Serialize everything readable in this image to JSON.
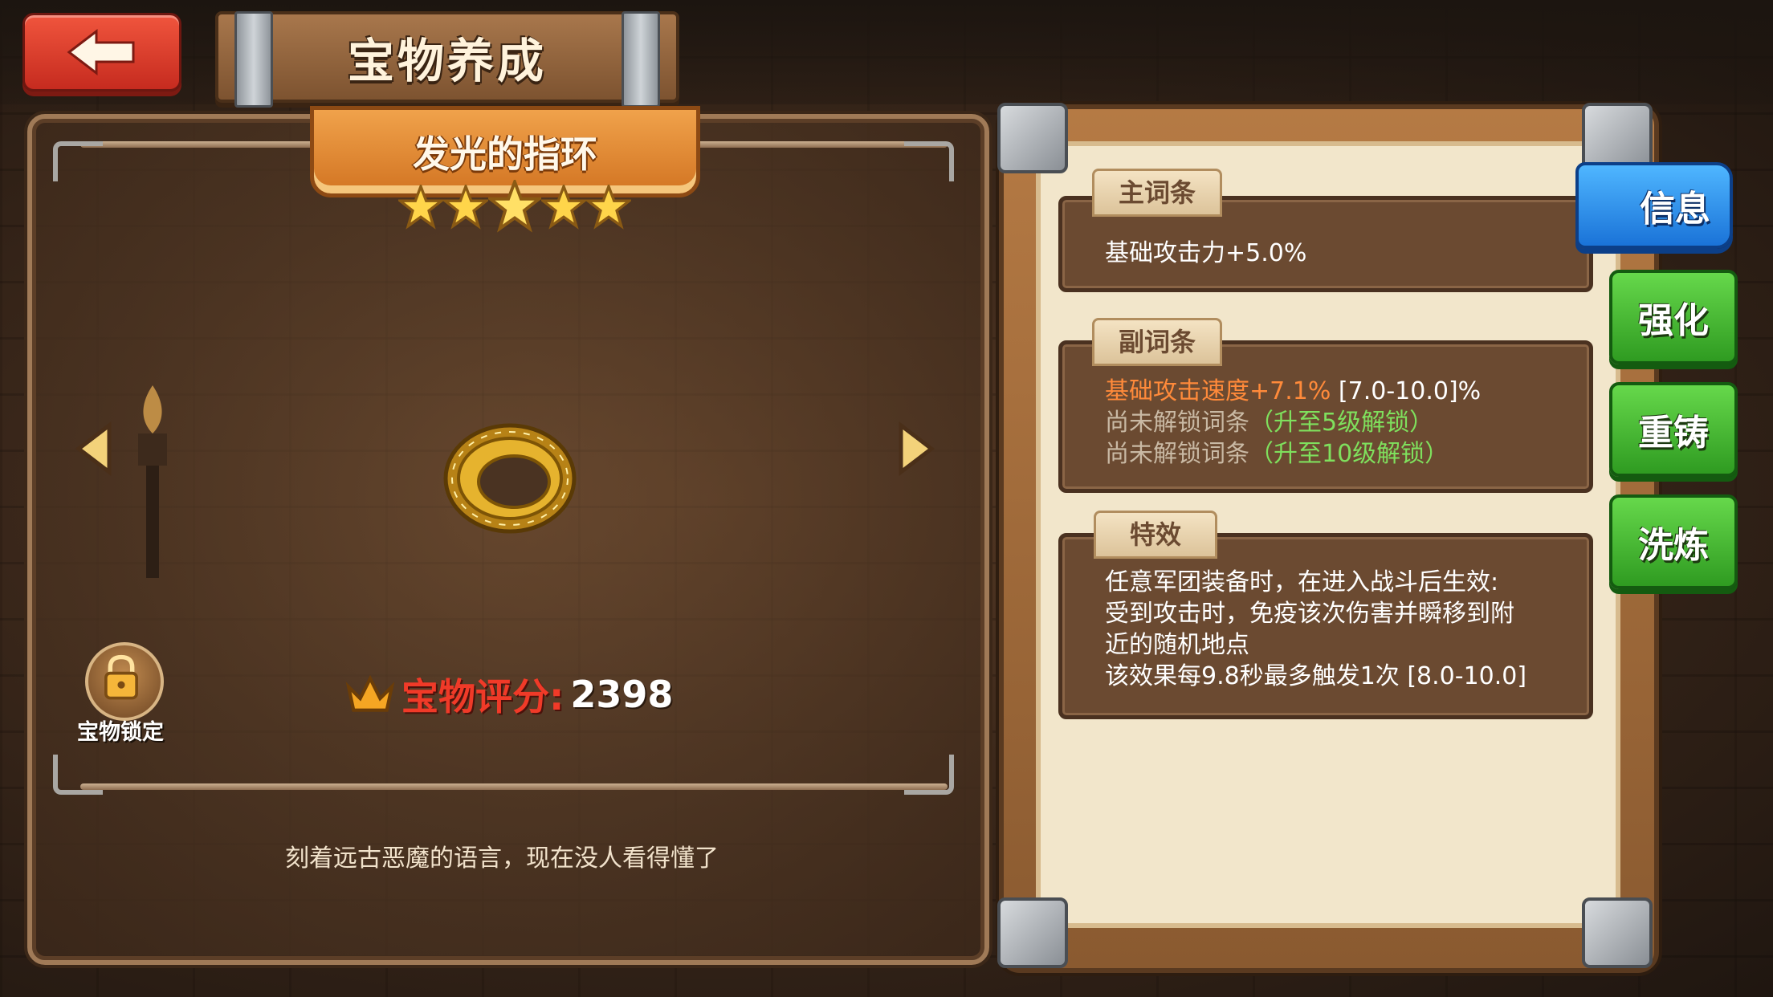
{
  "header": {
    "title": "宝物养成",
    "back_icon": "back-arrow-icon"
  },
  "treasure": {
    "name": "发光的指环",
    "stars": 5,
    "lock_label": "宝物锁定",
    "score_label": "宝物评分:",
    "score_value": "2398",
    "description": "刻着远古恶魔的语言，现在没人看得懂了"
  },
  "attributes": {
    "main": {
      "tag": "主词条",
      "line": "基础攻击力+5.0%"
    },
    "sub": {
      "tag": "副词条",
      "line1_main": "基础攻击速度+7.1%",
      "line1_range": "[7.0-10.0]%",
      "line2_main": "尚未解锁词条",
      "line2_hint": "（升至5级解锁）",
      "line3_main": "尚未解锁词条",
      "line3_hint": "（升至10级解锁）"
    },
    "effect": {
      "tag": "特效",
      "line1": "任意军团装备时，在进入战斗后生效:",
      "line2": "受到攻击时，免疫该次伤害并瞬移到附",
      "line3": "近的随机地点",
      "line4_main": "该效果每9.8秒最多触发1次",
      "line4_range": "[8.0-10.0]"
    }
  },
  "tabs": {
    "info": "信息",
    "enhance": "强化",
    "recast": "重铸",
    "refine": "洗炼"
  },
  "colors": {
    "back_button": "#d8372a",
    "ribbon": "#e38a33",
    "score_label": "#f03a28",
    "orange_text": "#ff8a3a",
    "green_text": "#7fe05d",
    "info_tab": "#2f8ef0",
    "green_tab": "#3fae2c"
  }
}
